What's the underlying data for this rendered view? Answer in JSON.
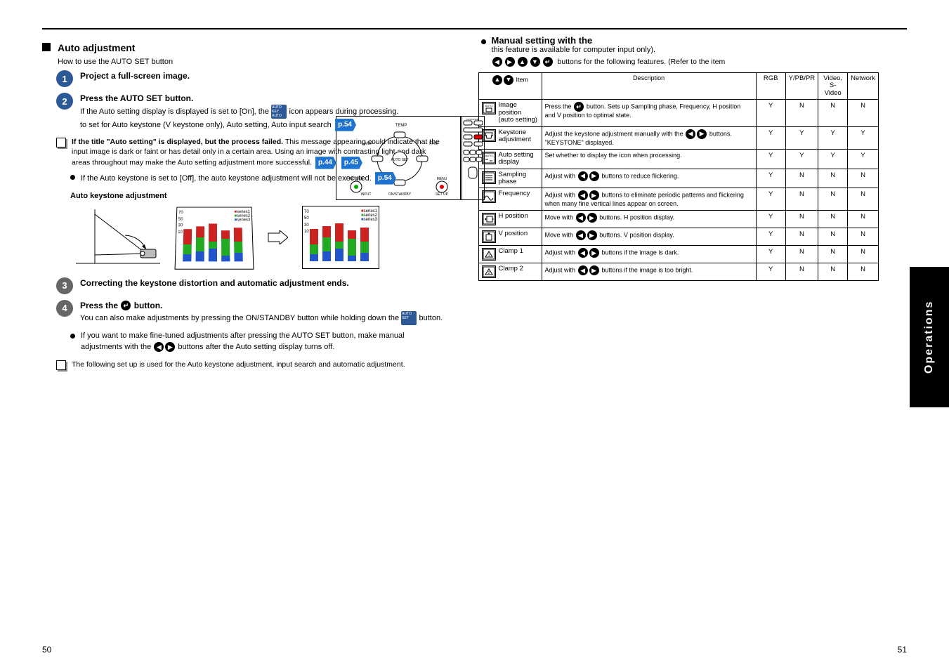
{
  "header": {
    "title": "Auto adjustment",
    "subtitle": "How to use the AUTO SET button"
  },
  "steps": {
    "s1": {
      "title": "Project a full-screen image."
    },
    "s2": {
      "title": "Press the AUTO SET button.",
      "detail_pre": "If the Auto setting display is displayed is set to [On], the ",
      "detail_post": " icon appears during processing."
    },
    "subfeatures": "to set for Auto keystone (V keystone only), Auto setting, Auto input search",
    "ref1": "p.54",
    "ref2a": "p.44",
    "ref2b": "p.45"
  },
  "note_a": {
    "title": "If the title \"Auto setting\" is displayed, but the process failed.",
    "body": "This message appearing could indicate that the input image is dark or faint or has detail only in a certain area. Using an image with contrasting light and dark areas throughout may make the Auto setting adjustment more successful."
  },
  "bullet_a": {
    "pre": "If the Auto keystone is set to [Off], the auto keystone adjustment will not be executed.",
    "ref": "p.54"
  },
  "diag_caption": "Auto keystone adjustment",
  "s3": {
    "title": "Correcting the keystone distortion and automatic adjustment ends."
  },
  "s4": {
    "title_pre": "Press the ",
    "title_post": " button.",
    "detail_pre": "You can also make adjustments by pressing the ON/STANDBY button while holding down the ",
    "detail_post": " button."
  },
  "bullet_b": {
    "pre": "If you want to make fine-tuned adjustments after pressing the AUTO SET button, make manual adjustments with the ",
    "post": " buttons after the Auto setting display turns off."
  },
  "note_b": "The following set up is used for the Auto keystone adjustment, input search and automatic adjustment.",
  "right": {
    "bullet_title": "Manual setting with the",
    "bullet_sub": "this feature is available for computer input only).",
    "adj_line": "buttons for the following features. (Refer to the item"
  },
  "table": {
    "heads": [
      "RGB",
      "Y/PB/PR",
      "Video, S-Video",
      "Network"
    ],
    "rows": [
      {
        "name": "Image position (auto setting)",
        "desc_pre": "Press the ",
        "desc_post": " button. Sets up Sampling phase, Frequency, H position and V position to optimal state.",
        "v": [
          "Y",
          "N",
          "N",
          "N"
        ]
      },
      {
        "name": "Keystone adjustment",
        "desc_pre": "Adjust the keystone adjustment manually with the ",
        "desc_post": " buttons. \"KEYSTONE\" displayed.",
        "v": [
          "Y",
          "Y",
          "Y",
          "Y"
        ]
      },
      {
        "name": "Auto setting display",
        "desc_pre": "Set whether to display the icon when processing.",
        "desc_post": "",
        "v": [
          "Y",
          "Y",
          "Y",
          "Y"
        ]
      },
      {
        "name": "Sampling phase",
        "desc_pre": "Adjust with ",
        "desc_post": " buttons to reduce flickering.",
        "v": [
          "Y",
          "N",
          "N",
          "N"
        ]
      },
      {
        "name": "Frequency",
        "desc_pre": "Adjust with ",
        "desc_post": " buttons to eliminate periodic patterns and flickering when many fine vertical lines appear on screen.",
        "v": [
          "Y",
          "N",
          "N",
          "N"
        ]
      },
      {
        "name": "H position",
        "desc_pre": "Move with ",
        "desc_post": " buttons. H position display.",
        "v": [
          "Y",
          "N",
          "N",
          "N"
        ]
      },
      {
        "name": "V position",
        "desc_pre": "Move with ",
        "desc_post": " buttons. V position display.",
        "v": [
          "Y",
          "N",
          "N",
          "N"
        ]
      },
      {
        "name": "Clamp 1",
        "desc_pre": "Adjust with ",
        "desc_post": " buttons if the image is dark.",
        "v": [
          "Y",
          "N",
          "N",
          "N"
        ]
      },
      {
        "name": "Clamp 2",
        "desc_pre": "Adjust with ",
        "desc_post": " buttons if the image is too bright.",
        "v": [
          "Y",
          "N",
          "N",
          "N"
        ]
      }
    ]
  },
  "side_tab": "Operations",
  "page_left": "50",
  "page_right": "51",
  "remote_labels": {
    "top": "TEMP",
    "l1": "LAMP",
    "l2": "FAN",
    "center": "AUTOSET",
    "bottom": "ON/STANDBY",
    "right": "INPUT"
  }
}
